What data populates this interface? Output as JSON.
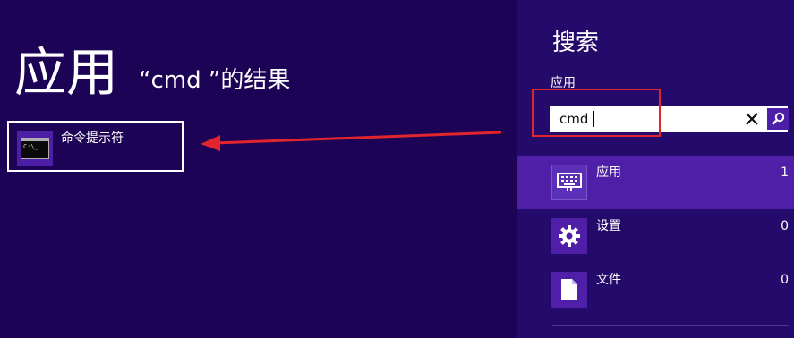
{
  "results_panel": {
    "heading": "应用",
    "subheading": "“cmd ”的结果",
    "results": [
      {
        "label": "命令提示符",
        "icon": "command-prompt-icon",
        "icon_text": "C:\\_"
      }
    ]
  },
  "search_panel": {
    "title": "搜索",
    "scope_label": "应用",
    "query": "cmd",
    "categories": [
      {
        "label": "应用",
        "count": "1",
        "icon": "keyboard-icon"
      },
      {
        "label": "设置",
        "count": "0",
        "icon": "gear-icon"
      },
      {
        "label": "文件",
        "count": "0",
        "icon": "document-icon"
      }
    ]
  },
  "annotations": {
    "highlight_color": "#e0262c",
    "arrow_color": "#e0262c"
  },
  "colors": {
    "background": "#1c0355",
    "panel": "#240a6b",
    "accent": "#4f1fa8"
  }
}
